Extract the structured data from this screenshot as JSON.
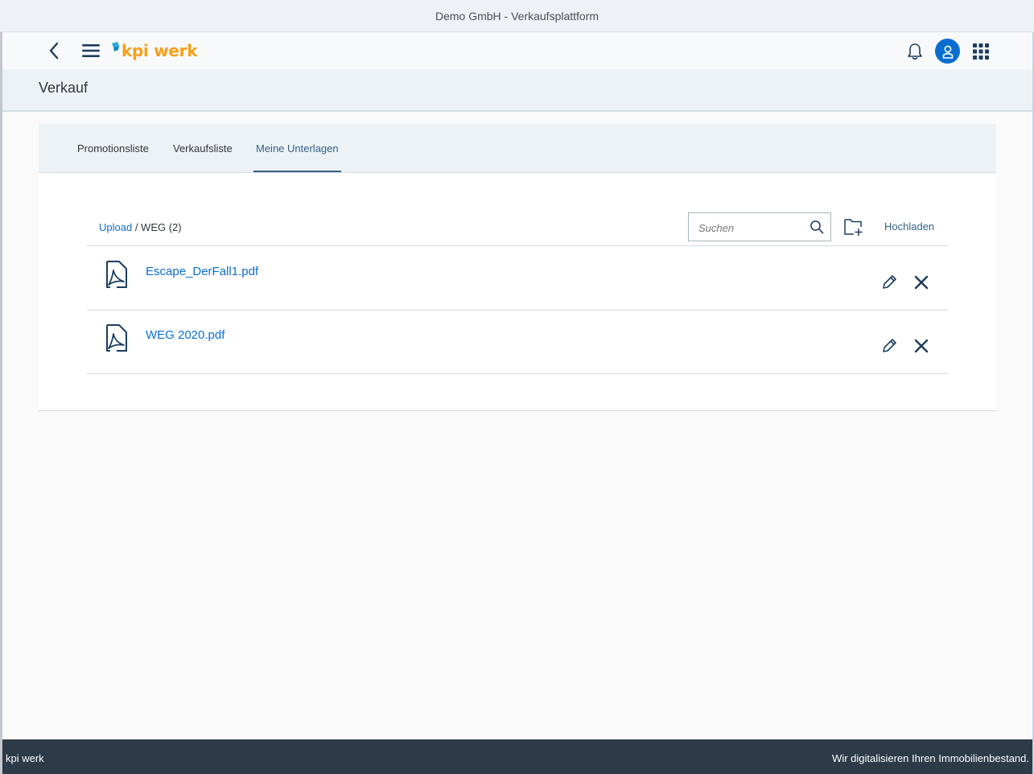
{
  "window": {
    "title": "Demo GmbH - Verkaufsplattform"
  },
  "shell": {
    "brand": "kpi werk",
    "brand_color": "#f6a01a",
    "accent": "#0a6ed1",
    "icons": [
      "back-icon",
      "hamburger-menu-icon",
      "bell-icon",
      "user-icon",
      "app-grid-icon"
    ]
  },
  "page": {
    "title": "Verkauf"
  },
  "tabs": [
    {
      "label": "Promotionsliste",
      "active": false
    },
    {
      "label": "Verkaufsliste",
      "active": false
    },
    {
      "label": "Meine Unterlagen",
      "active": true
    }
  ],
  "documents": {
    "breadcrumb_link": "Upload",
    "breadcrumb_separator": " / ",
    "breadcrumb_current": "WEG (2)",
    "search": {
      "placeholder": "Suchen",
      "value": ""
    },
    "upload_label": "Hochladen",
    "files": [
      {
        "name": "Escape_DerFall1.pdf",
        "icon": "pdf-file-icon"
      },
      {
        "name": "WEG 2020.pdf",
        "icon": "pdf-file-icon"
      }
    ]
  },
  "footer": {
    "left": "kpi werk",
    "right": "Wir digitalisieren Ihren Immobilienbestand."
  }
}
